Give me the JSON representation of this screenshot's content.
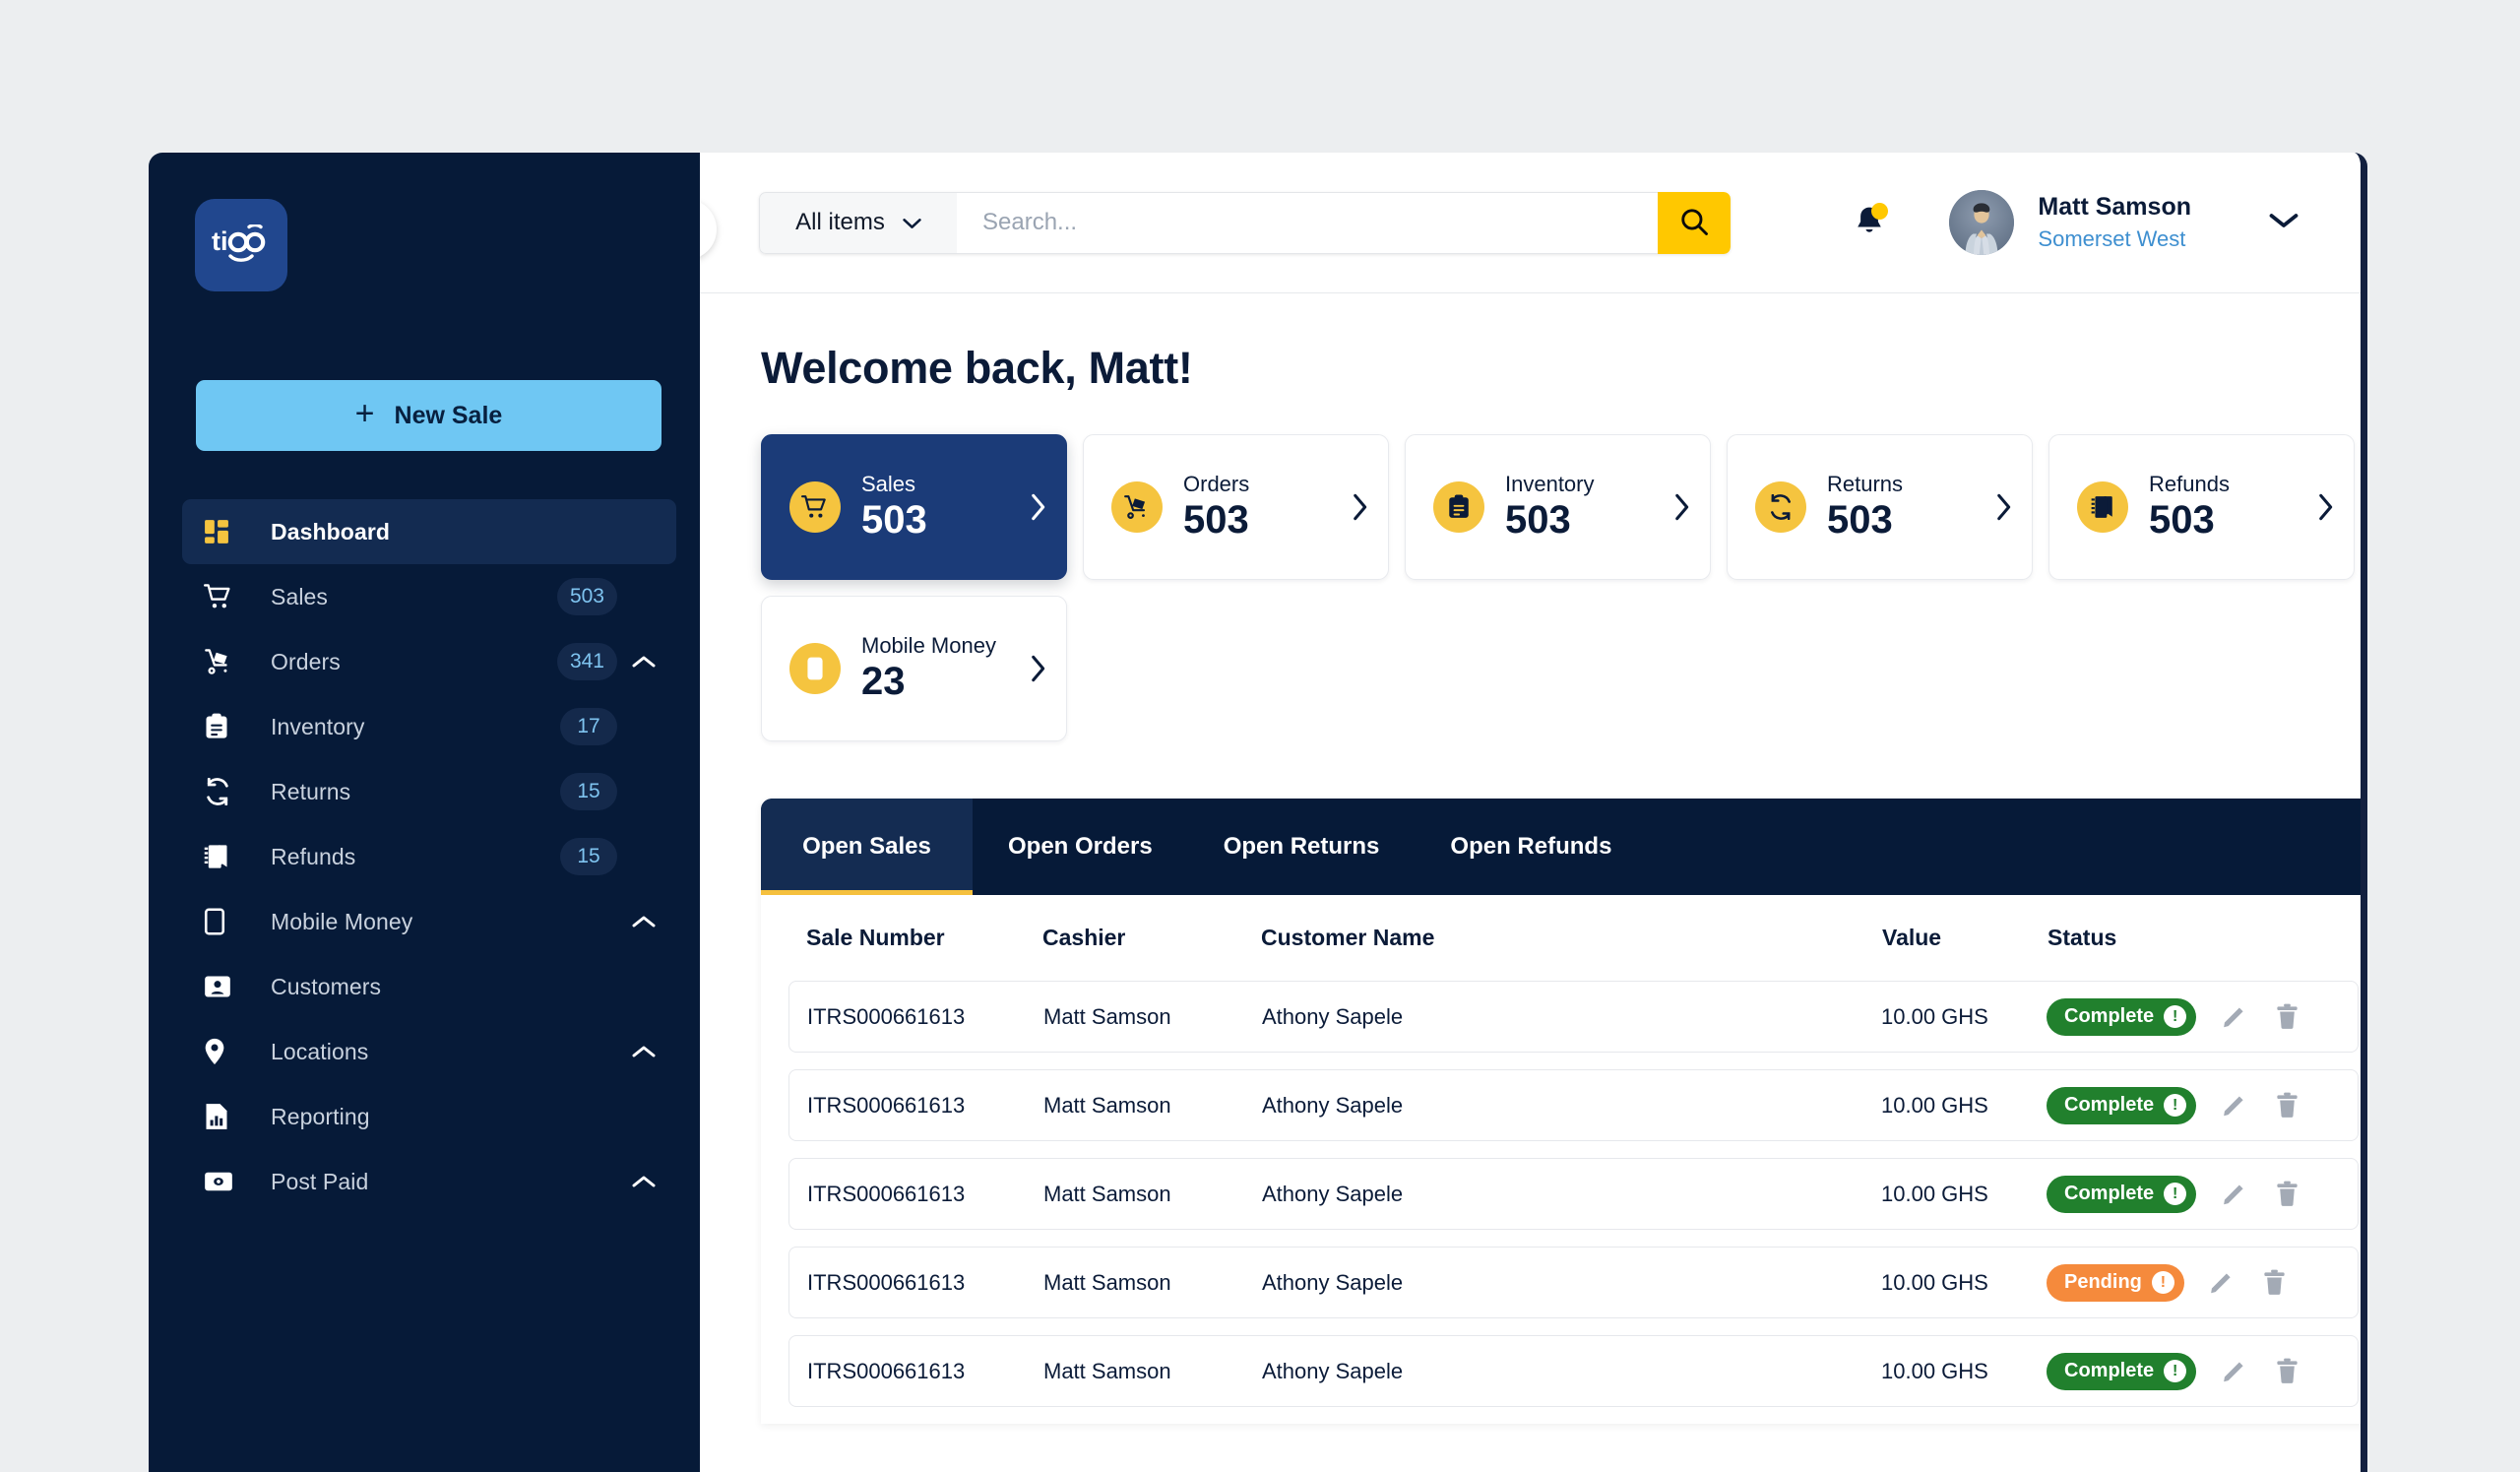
{
  "brand": {
    "logo_text": "tigo",
    "colors": {
      "sidebar_navy": "#061A38",
      "accent_yellow": "#FFC800",
      "badge_yellow": "#F5C43F",
      "card_active_blue": "#1B3B78",
      "new_sale_blue": "#6FC7F3",
      "link_blue": "#3E8FD0",
      "status_complete_green": "#21802D",
      "status_pending_orange": "#F58A3C",
      "tab_underline": "#F5C03E"
    }
  },
  "sidebar": {
    "new_sale_label": "New Sale",
    "new_sale_icon": "plus-icon",
    "collapse_icon": "chevron-left-icon",
    "items": [
      {
        "label": "Dashboard",
        "icon": "dashboard-grid-icon",
        "badge": "",
        "caret": false,
        "active": true
      },
      {
        "label": "Sales",
        "icon": "shopping-cart-icon",
        "badge": "503",
        "caret": false,
        "active": false
      },
      {
        "label": "Orders",
        "icon": "hand-truck-icon",
        "badge": "341",
        "caret": true,
        "active": false
      },
      {
        "label": "Inventory",
        "icon": "clipboard-icon",
        "badge": "17",
        "caret": false,
        "active": false
      },
      {
        "label": "Returns",
        "icon": "refresh-cycle-icon",
        "badge": "15",
        "caret": false,
        "active": false
      },
      {
        "label": "Refunds",
        "icon": "receipt-book-icon",
        "badge": "15",
        "caret": false,
        "active": false
      },
      {
        "label": "Mobile Money",
        "icon": "mobile-phone-icon",
        "badge": "",
        "caret": true,
        "active": false
      },
      {
        "label": "Customers",
        "icon": "contact-card-icon",
        "badge": "",
        "caret": false,
        "active": false
      },
      {
        "label": "Locations",
        "icon": "map-pin-icon",
        "badge": "",
        "caret": true,
        "active": false
      },
      {
        "label": "Reporting",
        "icon": "report-chart-icon",
        "badge": "",
        "caret": false,
        "active": false
      },
      {
        "label": "Post Paid",
        "icon": "cash-note-icon",
        "badge": "",
        "caret": true,
        "active": false
      }
    ]
  },
  "topbar": {
    "category_value": "All items",
    "category_caret_icon": "chevron-down-icon",
    "search_placeholder": "Search...",
    "search_value": "",
    "search_button_icon": "search-icon",
    "bell_icon": "notification-bell-icon",
    "user": {
      "avatar": "user-avatar-photo",
      "name": "Matt Samson",
      "location": "Somerset West",
      "caret_icon": "chevron-down-icon"
    }
  },
  "main": {
    "page_title": "Welcome back, Matt!",
    "stat_cards": [
      {
        "label": "Sales",
        "value": "503",
        "icon": "shopping-cart-icon",
        "active": true
      },
      {
        "label": "Orders",
        "value": "503",
        "icon": "hand-truck-icon",
        "active": false
      },
      {
        "label": "Inventory",
        "value": "503",
        "icon": "clipboard-icon",
        "active": false
      },
      {
        "label": "Returns",
        "value": "503",
        "icon": "refresh-cycle-icon",
        "active": false
      },
      {
        "label": "Refunds",
        "value": "503",
        "icon": "receipt-book-icon",
        "active": false
      },
      {
        "label": "Mobile Money",
        "value": "23",
        "icon": "mobile-phone-icon",
        "active": false
      }
    ],
    "tabs": [
      {
        "label": "Open Sales",
        "active": true
      },
      {
        "label": "Open Orders",
        "active": false
      },
      {
        "label": "Open Returns",
        "active": false
      },
      {
        "label": "Open Refunds",
        "active": false
      }
    ],
    "table": {
      "columns": [
        "Sale Number",
        "Cashier",
        "Customer Name",
        "Value",
        "Status"
      ],
      "rows": [
        {
          "sale_number": "ITRS000661613",
          "cashier": "Matt Samson",
          "customer": "Athony Sapele",
          "value": "10.00 GHS",
          "status": "Complete",
          "status_type": "complete"
        },
        {
          "sale_number": "ITRS000661613",
          "cashier": "Matt Samson",
          "customer": "Athony Sapele",
          "value": "10.00 GHS",
          "status": "Complete",
          "status_type": "complete"
        },
        {
          "sale_number": "ITRS000661613",
          "cashier": "Matt Samson",
          "customer": "Athony Sapele",
          "value": "10.00 GHS",
          "status": "Complete",
          "status_type": "complete"
        },
        {
          "sale_number": "ITRS000661613",
          "cashier": "Matt Samson",
          "customer": "Athony Sapele",
          "value": "10.00 GHS",
          "status": "Pending",
          "status_type": "pending"
        },
        {
          "sale_number": "ITRS000661613",
          "cashier": "Matt Samson",
          "customer": "Athony Sapele",
          "value": "10.00 GHS",
          "status": "Complete",
          "status_type": "complete"
        }
      ],
      "row_actions": {
        "edit_icon": "pencil-edit-icon",
        "delete_icon": "trash-delete-icon"
      },
      "status_info_icon": "exclamation-icon"
    }
  }
}
